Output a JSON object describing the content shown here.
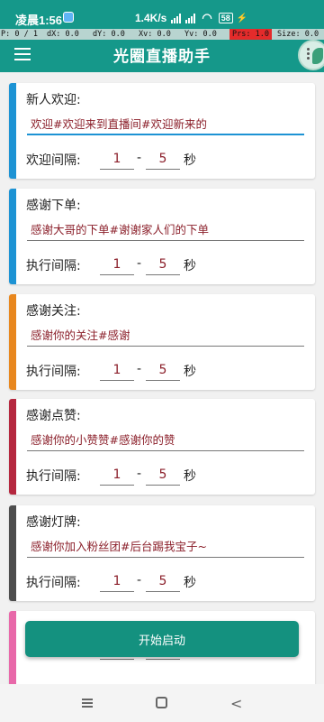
{
  "status_bar": {
    "time": "凌晨1:56",
    "network_speed": "1.4K/s",
    "battery_level": "58"
  },
  "pointer_location": {
    "p": "P: 0 / 1",
    "dx": "dX: 0.0",
    "dy": "dY: 0.0",
    "xv": "Xv: 0.0",
    "yv": "Yv: 0.0",
    "prs": "Prs: 1.0",
    "size": "Size: 0.0"
  },
  "app_bar": {
    "title": "光圈直播助手"
  },
  "cards": [
    {
      "title": "新人欢迎:",
      "message": "欢迎#欢迎来到直播间#欢迎新来的",
      "interval_label": "欢迎间隔:",
      "min": "1",
      "max": "5",
      "unit": "秒",
      "color": "#1d93d4"
    },
    {
      "title": "感谢下单:",
      "message": "感谢大哥的下单#谢谢家人们的下单",
      "interval_label": "执行间隔:",
      "min": "1",
      "max": "5",
      "unit": "秒",
      "color": "#1d93d4"
    },
    {
      "title": "感谢关注:",
      "message": "感谢你的关注#感谢",
      "interval_label": "执行间隔:",
      "min": "1",
      "max": "5",
      "unit": "秒",
      "color": "#e8871e"
    },
    {
      "title": "感谢点赞:",
      "message": "感谢你的小赞赞#感谢你的赞",
      "interval_label": "执行间隔:",
      "min": "1",
      "max": "5",
      "unit": "秒",
      "color": "#b5283f"
    },
    {
      "title": "感谢灯牌:",
      "message": "感谢你加入粉丝团#后台踢我宝子~",
      "interval_label": "执行间隔:",
      "min": "1",
      "max": "5",
      "unit": "秒",
      "color": "#4d4d4d"
    },
    {
      "title": "",
      "message": "",
      "interval_label": "",
      "min": "",
      "max": "",
      "unit": "",
      "color": "#e868a9"
    }
  ],
  "start_button": {
    "label": "开始启动"
  },
  "colors": {
    "primary": "#15988a",
    "accent_text": "#8b1f2a"
  },
  "icons": {
    "menu": "menu-icon",
    "floating": "floating-assistant-icon",
    "recent": "recent-apps-icon",
    "home": "home-icon",
    "back": "back-icon"
  }
}
